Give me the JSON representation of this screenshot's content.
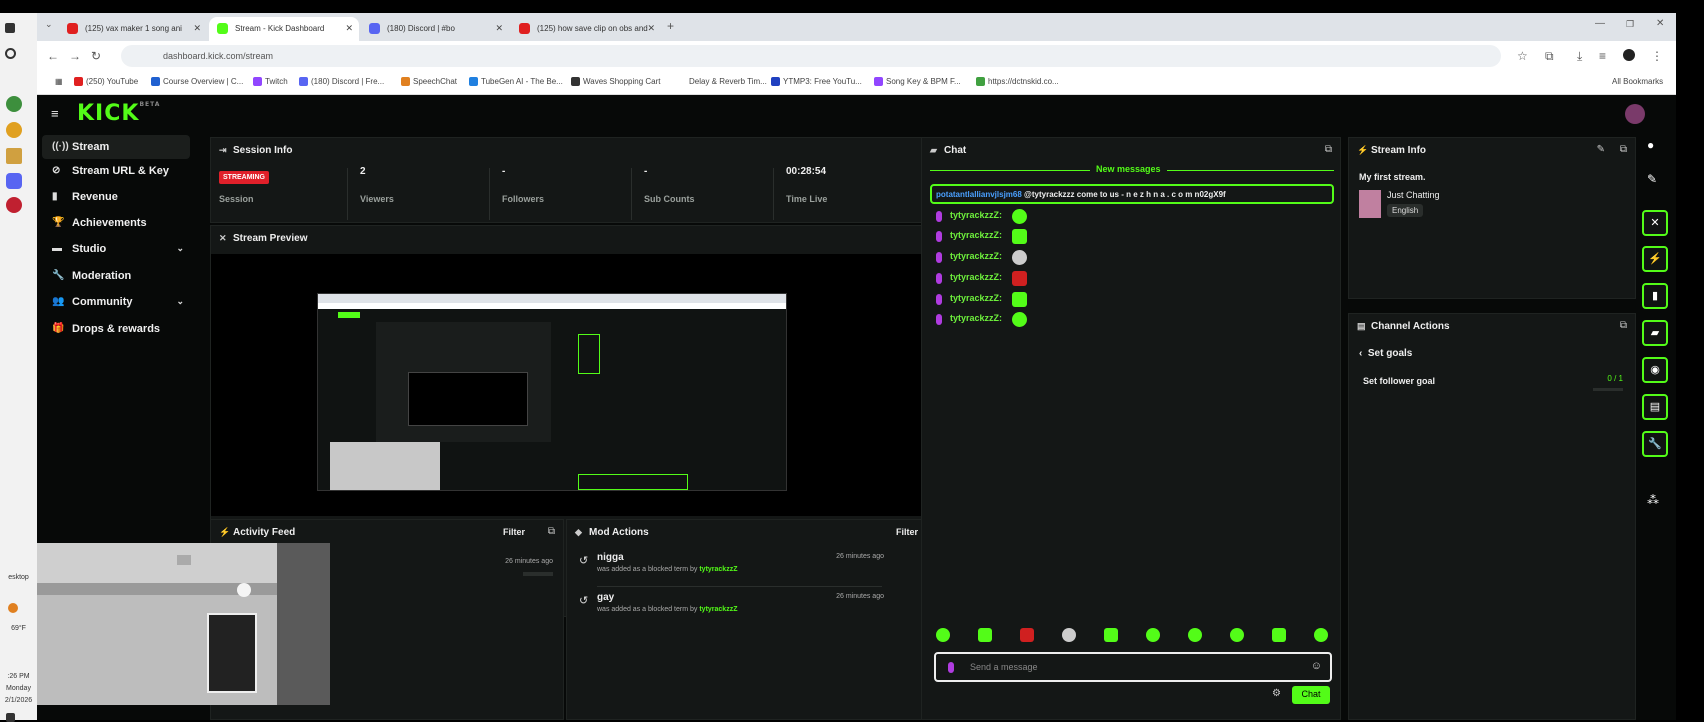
{
  "browser": {
    "tabs": [
      {
        "title": "(125) vax maker 1 song ani",
        "color": "#e02020"
      },
      {
        "title": "Stream - Kick Dashboard",
        "color": "#53fc18",
        "active": true
      },
      {
        "title": "(180) Discord | #bo",
        "color": "#5865f2"
      },
      {
        "title": "(125) how save clip on obs and",
        "color": "#e02020"
      }
    ],
    "url": "dashboard.kick.com/stream",
    "bookmarks": [
      "(250) YouTube",
      "Course Overview | C...",
      "Twitch",
      "(180) Discord | Fre...",
      "SpeechChat",
      "TubeGen AI - The Be...",
      "Waves Shopping Cart",
      "Delay & Reverb Tim...",
      "YTMP3: Free YouTu...",
      "Song Key & BPM F...",
      "https://dctnskid.co..."
    ],
    "all_bookmarks": "All Bookmarks"
  },
  "taskbar": {
    "desktop": "esktop",
    "temp": "69°F",
    "time": ":26 PM",
    "day": "Monday",
    "date": "2/1/2026"
  },
  "kick": {
    "logo": "KICK",
    "logo_badge": "BETA",
    "nav": [
      {
        "label": "Stream",
        "icon": "((·))",
        "active": true
      },
      {
        "label": "Stream URL & Key",
        "icon": "⊘"
      },
      {
        "label": "Revenue",
        "icon": "▮"
      },
      {
        "label": "Achievements",
        "icon": "🏆"
      },
      {
        "label": "Studio",
        "icon": "▬",
        "chevron": true
      },
      {
        "label": "Moderation",
        "icon": "🔧"
      },
      {
        "label": "Community",
        "icon": "👥",
        "chevron": true
      },
      {
        "label": "Drops & rewards",
        "icon": "🎁"
      }
    ]
  },
  "session": {
    "title": "Session Info",
    "status_badge": "STREAMING",
    "stats": [
      {
        "value": "",
        "label": "Session"
      },
      {
        "value": "2",
        "label": "Viewers"
      },
      {
        "value": "-",
        "label": "Followers"
      },
      {
        "value": "-",
        "label": "Sub Counts"
      },
      {
        "value": "00:28:54",
        "label": "Time Live"
      }
    ]
  },
  "preview": {
    "title": "Stream Preview"
  },
  "activity": {
    "title": "Activity Feed",
    "filter": "Filter",
    "time": "26 minutes ago"
  },
  "mod_actions": {
    "title": "Mod Actions",
    "filter": "Filter",
    "items": [
      {
        "term": "nigga",
        "desc_prefix": "was added as a blocked term by",
        "user": "tytyrackzzZ",
        "time": "26 minutes ago"
      },
      {
        "term": "gay",
        "desc_prefix": "was added as a blocked term by",
        "user": "tytyrackzzZ",
        "time": "26 minutes ago"
      }
    ]
  },
  "chat": {
    "title": "Chat",
    "new_messages": "New messages",
    "highlight_user": "potatantlallianvjlsjm68",
    "highlight_text": "@tytyrackzzz come to us - n e z h n a . c o m n02gX9f",
    "messages": [
      {
        "user": "tytyrackzzZ:"
      },
      {
        "user": "tytyrackzzZ:"
      },
      {
        "user": "tytyrackzzZ:"
      },
      {
        "user": "tytyrackzzZ:"
      },
      {
        "user": "tytyrackzzZ:"
      },
      {
        "user": "tytyrackzzZ:"
      }
    ],
    "input_placeholder": "Send a message",
    "send_label": "Chat"
  },
  "stream_info": {
    "title": "Stream Info",
    "stream_title": "My first stream.",
    "category": "Just Chatting",
    "language": "English"
  },
  "channel_actions": {
    "title": "Channel Actions",
    "back_label": "Set goals",
    "goal_label": "Set follower goal",
    "goal_value": "0 / 1"
  },
  "colors": {
    "accent": "#53fc18",
    "live": "#e0202a",
    "bg": "#070908",
    "panel": "#141716"
  }
}
